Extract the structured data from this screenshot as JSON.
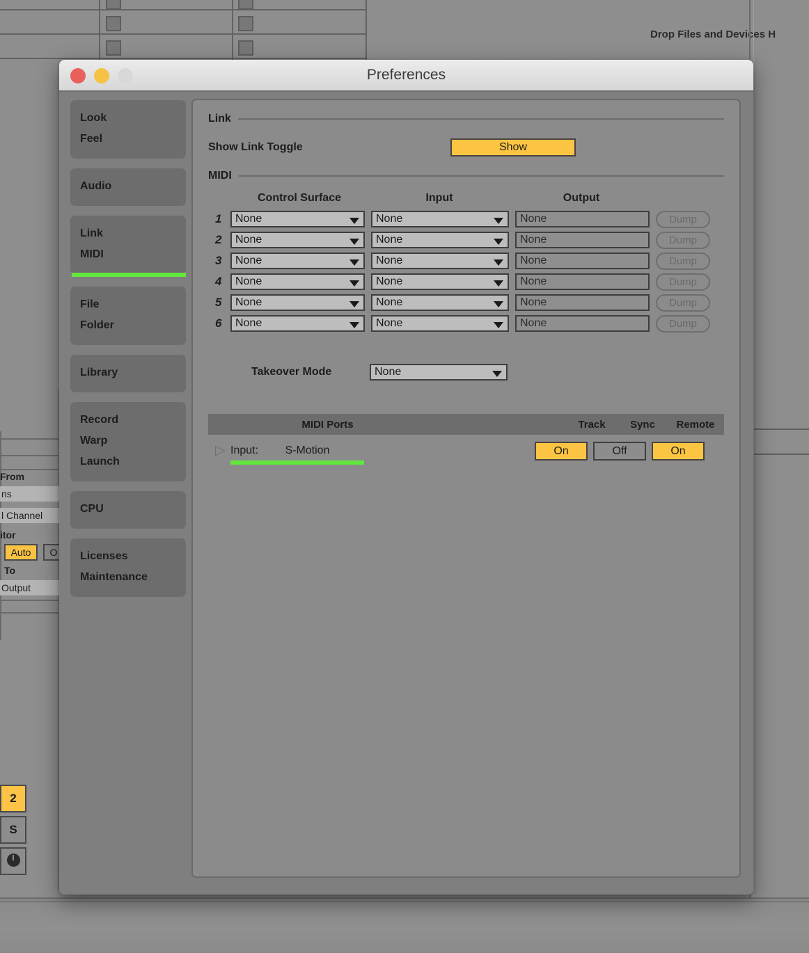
{
  "background": {
    "drop_files_label": "Drop Files and Devices H",
    "track_io": {
      "from_label": "From",
      "inputs_value": "ns",
      "channel_value": "l Channel",
      "monitor_label": "itor",
      "monitor_auto": "Auto",
      "monitor_other": "O",
      "to_label": "To",
      "output_value": "Output"
    },
    "track_buttons": {
      "track_number": "2",
      "solo": "S",
      "arm": "record-arm"
    }
  },
  "window": {
    "title": "Preferences",
    "traffic_lights": [
      {
        "name": "close-button",
        "color": "#e8605a"
      },
      {
        "name": "minimize-button",
        "color": "#f6c244"
      },
      {
        "name": "zoom-button",
        "color": "#d8d8d8"
      }
    ]
  },
  "sidebar": {
    "groups": [
      {
        "name": "look-feel",
        "selected": false,
        "items": [
          "Look",
          "Feel"
        ]
      },
      {
        "name": "audio",
        "selected": false,
        "items": [
          "Audio"
        ]
      },
      {
        "name": "link-midi",
        "selected": true,
        "items": [
          "Link",
          "MIDI"
        ]
      },
      {
        "name": "file-folder",
        "selected": false,
        "items": [
          "File",
          "Folder"
        ]
      },
      {
        "name": "library",
        "selected": false,
        "items": [
          "Library"
        ]
      },
      {
        "name": "record-warp-launch",
        "selected": false,
        "items": [
          "Record",
          "Warp",
          "Launch"
        ]
      },
      {
        "name": "cpu",
        "selected": false,
        "items": [
          "CPU"
        ]
      },
      {
        "name": "licenses-maintenance",
        "selected": false,
        "items": [
          "Licenses",
          "Maintenance"
        ]
      }
    ]
  },
  "content": {
    "link_section": {
      "title": "Link",
      "show_link_toggle_label": "Show Link Toggle",
      "show_link_toggle_value": "Show"
    },
    "midi_section": {
      "title": "MIDI",
      "columns": [
        "Control Surface",
        "Input",
        "Output"
      ],
      "dump_label": "Dump",
      "rows": [
        {
          "index": "1",
          "control_surface": "None",
          "input": "None",
          "output": "None"
        },
        {
          "index": "2",
          "control_surface": "None",
          "input": "None",
          "output": "None"
        },
        {
          "index": "3",
          "control_surface": "None",
          "input": "None",
          "output": "None"
        },
        {
          "index": "4",
          "control_surface": "None",
          "input": "None",
          "output": "None"
        },
        {
          "index": "5",
          "control_surface": "None",
          "input": "None",
          "output": "None"
        },
        {
          "index": "6",
          "control_surface": "None",
          "input": "None",
          "output": "None"
        }
      ],
      "takeover_mode_label": "Takeover Mode",
      "takeover_mode_value": "None"
    },
    "midi_ports": {
      "header": {
        "ports": "MIDI Ports",
        "track": "Track",
        "sync": "Sync",
        "remote": "Remote"
      },
      "rows": [
        {
          "kind": "Input:",
          "device": "S-Motion",
          "track": "On",
          "sync": "Off",
          "remote": "On",
          "remote_highlighted": true
        }
      ]
    }
  },
  "colors": {
    "accent_yellow": "#fbc543",
    "highlight_green": "#62e83c",
    "window_bg": "#7f7f7f",
    "panel_bg": "#8b8b8b"
  }
}
